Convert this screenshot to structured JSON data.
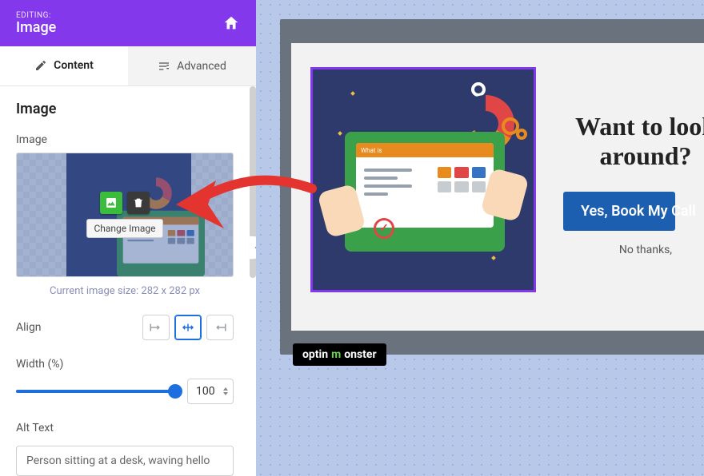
{
  "header": {
    "editing_label": "EDITING:",
    "editing_title": "Image"
  },
  "tabs": {
    "content": "Content",
    "advanced": "Advanced"
  },
  "section": {
    "title": "Image",
    "image_label": "Image",
    "thumb_tooltip": "Change Image",
    "size_hint": "Current image size: 282 x 282 px",
    "align_label": "Align",
    "width_label": "Width (%)",
    "width_value": "100",
    "alt_label": "Alt Text",
    "alt_value": "Person sitting at a desk, waving hello"
  },
  "preview": {
    "banner_text": "What is",
    "headline_line1": "Want to look",
    "headline_line2": "around?",
    "cta": "Yes, Book My Call",
    "decline": "No thanks,",
    "brand": "optinmonster"
  },
  "colors": {
    "accent": "#8338ec",
    "primary": "#1d6fe0",
    "cta": "#1c5fb0",
    "arrow": "#e3342f"
  }
}
